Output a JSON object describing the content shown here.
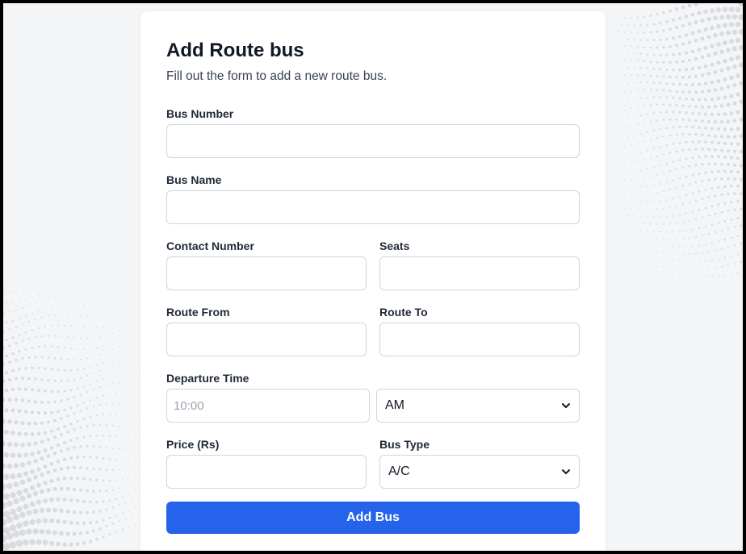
{
  "form": {
    "title": "Add Route bus",
    "subtitle": "Fill out the form to add a new route bus.",
    "bus_number": {
      "label": "Bus Number",
      "value": "",
      "placeholder": ""
    },
    "bus_name": {
      "label": "Bus Name",
      "value": "",
      "placeholder": ""
    },
    "contact_number": {
      "label": "Contact Number",
      "value": "",
      "placeholder": ""
    },
    "seats": {
      "label": "Seats",
      "value": "",
      "placeholder": ""
    },
    "route_from": {
      "label": "Route From",
      "value": "",
      "placeholder": ""
    },
    "route_to": {
      "label": "Route To",
      "value": "",
      "placeholder": ""
    },
    "departure_time": {
      "label": "Departure Time",
      "value": "",
      "placeholder": "10:00"
    },
    "meridiem": {
      "selected": "AM"
    },
    "price": {
      "label": "Price (Rs)",
      "value": "",
      "placeholder": ""
    },
    "bus_type": {
      "label": "Bus Type",
      "selected": "A/C"
    },
    "submit_label": "Add Bus"
  },
  "colors": {
    "accent": "#2563eb",
    "background": "#f4f5f7",
    "card": "#ffffff",
    "border": "#d1d5db",
    "text": "#111827"
  },
  "icons": {
    "select_arrow": "chevron-down-icon"
  }
}
